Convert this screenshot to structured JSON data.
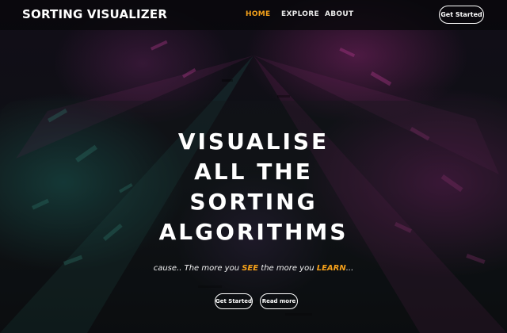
{
  "brand": {
    "name": "SORTING VISUALIZER"
  },
  "nav": {
    "items": [
      {
        "label": "HOME",
        "active": true
      },
      {
        "label": "EXPLORE",
        "active": false
      },
      {
        "label": "ABOUT",
        "active": false
      }
    ],
    "cta_label": "Get Started"
  },
  "hero": {
    "title_lines": [
      "VISUALISE",
      "ALL THE",
      "SORTING",
      "ALGORITHMS"
    ],
    "tagline": {
      "part1": "cause.. The more you ",
      "highlight1": "SEE",
      "part2": " the more you ",
      "highlight2": "LEARN",
      "part3": "..."
    },
    "buttons": {
      "get_started": "Get Started",
      "read_more": "Read more"
    }
  },
  "colors": {
    "accent": "#f5a11a",
    "navbar_bg": "#08080a",
    "text": "#ffffff"
  }
}
